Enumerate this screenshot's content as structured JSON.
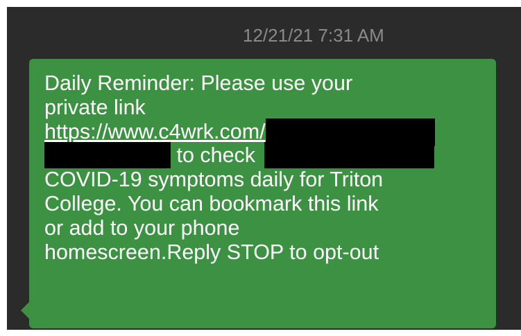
{
  "message": {
    "timestamp": "12/21/21 7:31 AM",
    "line1": "Daily Reminder: Please use your",
    "line2": "private link",
    "link_text": "https://www.c4wrk.com/",
    "link_tail": "",
    "line4_text": " to check ",
    "line5": "COVID-19 symptoms daily for Triton",
    "line6": "College. You can bookmark this link",
    "line7": "or add to your phone",
    "line8": "homescreen.Reply STOP to opt-out",
    "bubble_color": "#3d9142",
    "background_color": "#2b2b2b",
    "timestamp_color": "#8a8a8a"
  }
}
